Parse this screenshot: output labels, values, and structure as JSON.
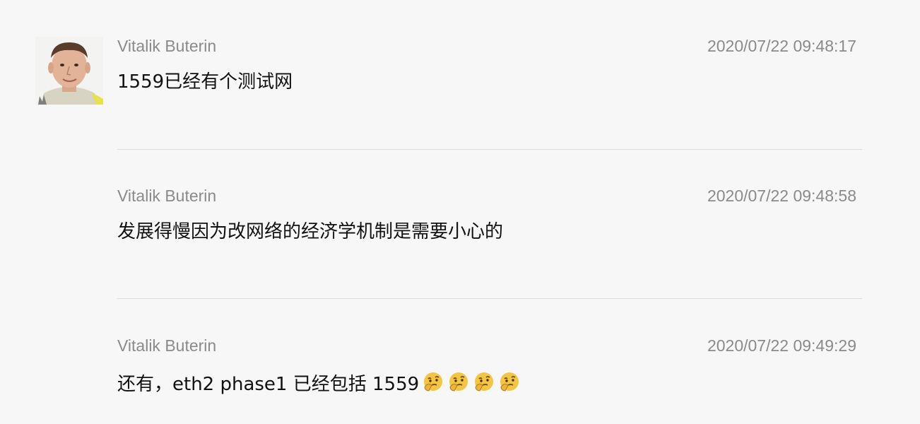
{
  "messages": [
    {
      "author": "Vitalik Buterin",
      "timestamp": "2020/07/22 09:48:17",
      "text": "1559已经有个测试网",
      "has_avatar": true
    },
    {
      "author": "Vitalik Buterin",
      "timestamp": "2020/07/22 09:48:58",
      "text": "发展得慢因为改网络的经济学机制是需要小心的",
      "has_avatar": false
    },
    {
      "author": "Vitalik Buterin",
      "timestamp": "2020/07/22 09:49:29",
      "text": "还有，eth2 phase1 已经包括 1559",
      "emoji": [
        "thinking-face-icon",
        "thinking-face-icon",
        "thinking-face-icon",
        "thinking-face-icon"
      ],
      "has_avatar": false
    }
  ],
  "colors": {
    "background": "#f7f7f7",
    "meta_text": "#8a8a8a",
    "body_text": "#111111",
    "divider": "#dcdcdc",
    "emoji_face": "#f4c542"
  }
}
